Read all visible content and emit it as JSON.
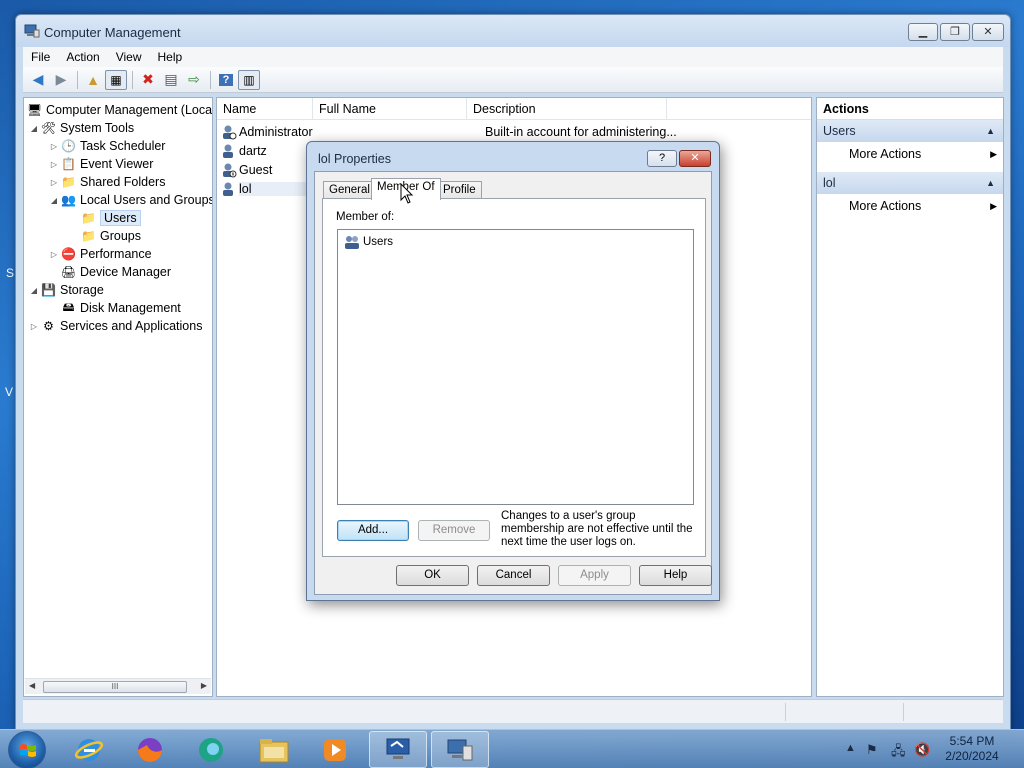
{
  "window": {
    "title": "Computer Management",
    "caption_buttons": [
      "minimize-icon",
      "maximize-icon",
      "close-icon"
    ]
  },
  "menu": [
    "File",
    "Action",
    "View",
    "Help"
  ],
  "tree": {
    "root": "Computer Management (Local",
    "system_tools": "System Tools",
    "task_scheduler": "Task Scheduler",
    "event_viewer": "Event Viewer",
    "shared_folders": "Shared Folders",
    "local_users_groups": "Local Users and Groups",
    "users": "Users",
    "groups": "Groups",
    "performance": "Performance",
    "device_manager": "Device Manager",
    "storage": "Storage",
    "disk_management": "Disk Management",
    "services_apps": "Services and Applications",
    "scroll_thumb": "III"
  },
  "list": {
    "columns": [
      "Name",
      "Full Name",
      "Description"
    ],
    "rows": [
      {
        "name": "Administrator",
        "full_name": "",
        "description": "Built-in account for administering..."
      },
      {
        "name": "dartz",
        "full_name": "",
        "description": ""
      },
      {
        "name": "Guest",
        "full_name": "",
        "description": ""
      },
      {
        "name": "lol",
        "full_name": "",
        "description": ""
      }
    ]
  },
  "actions": {
    "title": "Actions",
    "sections": [
      {
        "label": "Users",
        "item": "More Actions"
      },
      {
        "label": "lol",
        "item": "More Actions"
      }
    ]
  },
  "dialog": {
    "title": "lol Properties",
    "help": "?",
    "tabs": [
      "General",
      "Member Of",
      "Profile"
    ],
    "active_tab": "Member Of",
    "member_of_label": "Member of:",
    "members": [
      "Users"
    ],
    "add": "Add...",
    "remove": "Remove",
    "note": "Changes to a user's group membership are not effective until the next time the user logs on.",
    "ok": "OK",
    "cancel": "Cancel",
    "apply": "Apply",
    "help_button": "Help"
  },
  "taskbar": {
    "time": "5:54 PM",
    "date": "2/20/2024"
  },
  "colors": {
    "window_frame": "#c9dbef",
    "selection": "#dceaf9",
    "actions_section": "#c6d8ee",
    "close_button": "#c9402c"
  }
}
